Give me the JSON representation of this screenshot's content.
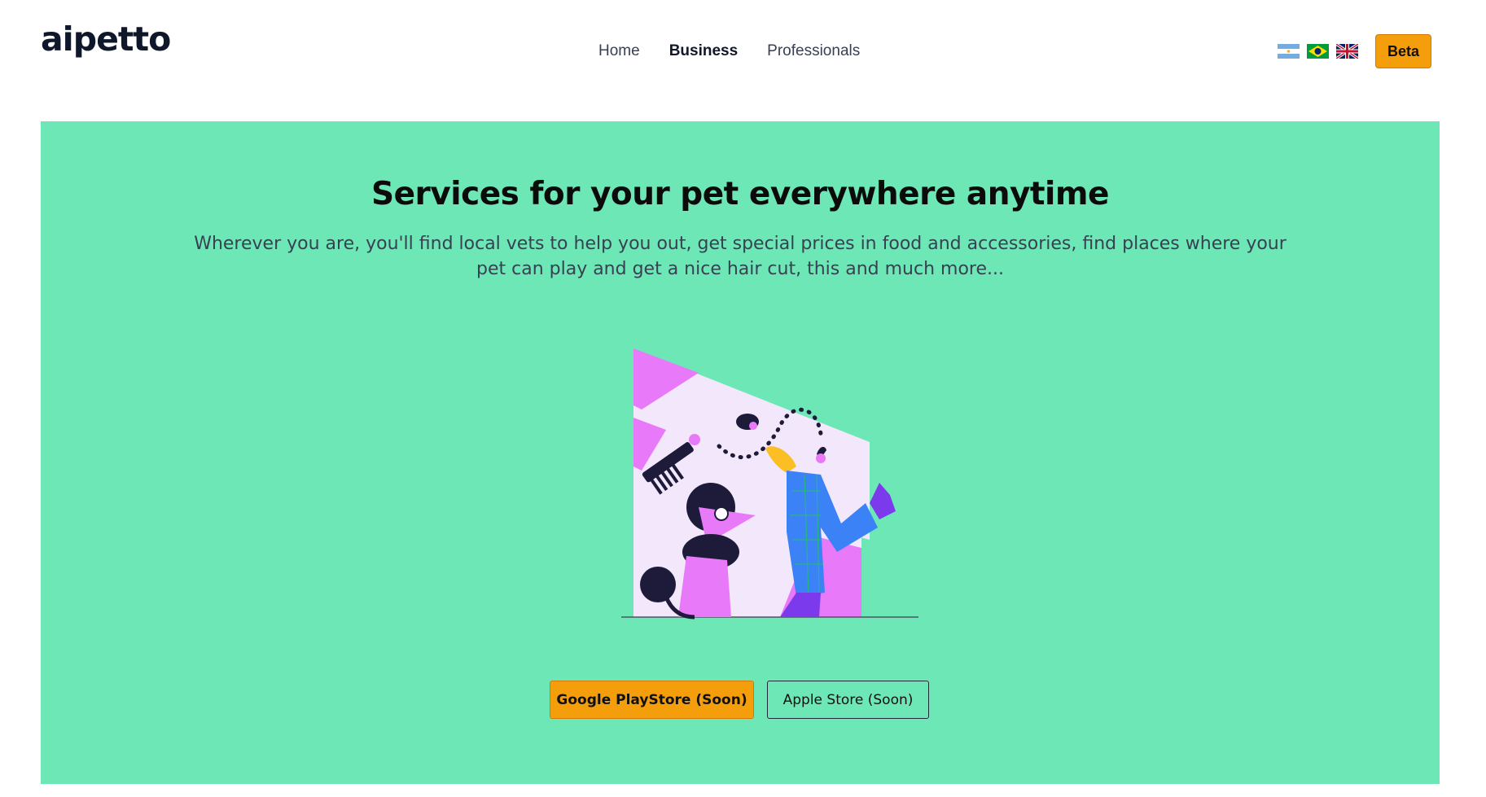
{
  "brand": {
    "logo": "aipetto"
  },
  "nav": {
    "home": "Home",
    "business": "Business",
    "professionals": "Professionals"
  },
  "languages": [
    {
      "icon": "argentina-flag-icon"
    },
    {
      "icon": "brazil-flag-icon"
    },
    {
      "icon": "uk-flag-icon"
    }
  ],
  "header": {
    "beta_label": "Beta"
  },
  "hero": {
    "title": "Services for your pet everywhere anytime",
    "subtitle": "Wherever you are, you'll find local vets to help you out, get special prices in food and accessories, find places where your pet can play and get a nice hair cut, this and much more...",
    "google_button": "Google PlayStore (Soon)",
    "apple_button": "Apple Store (Soon)"
  },
  "colors": {
    "accent": "#f59e0b",
    "hero_bg": "#6ee7b7",
    "illustration_pink": "#e879f9"
  }
}
